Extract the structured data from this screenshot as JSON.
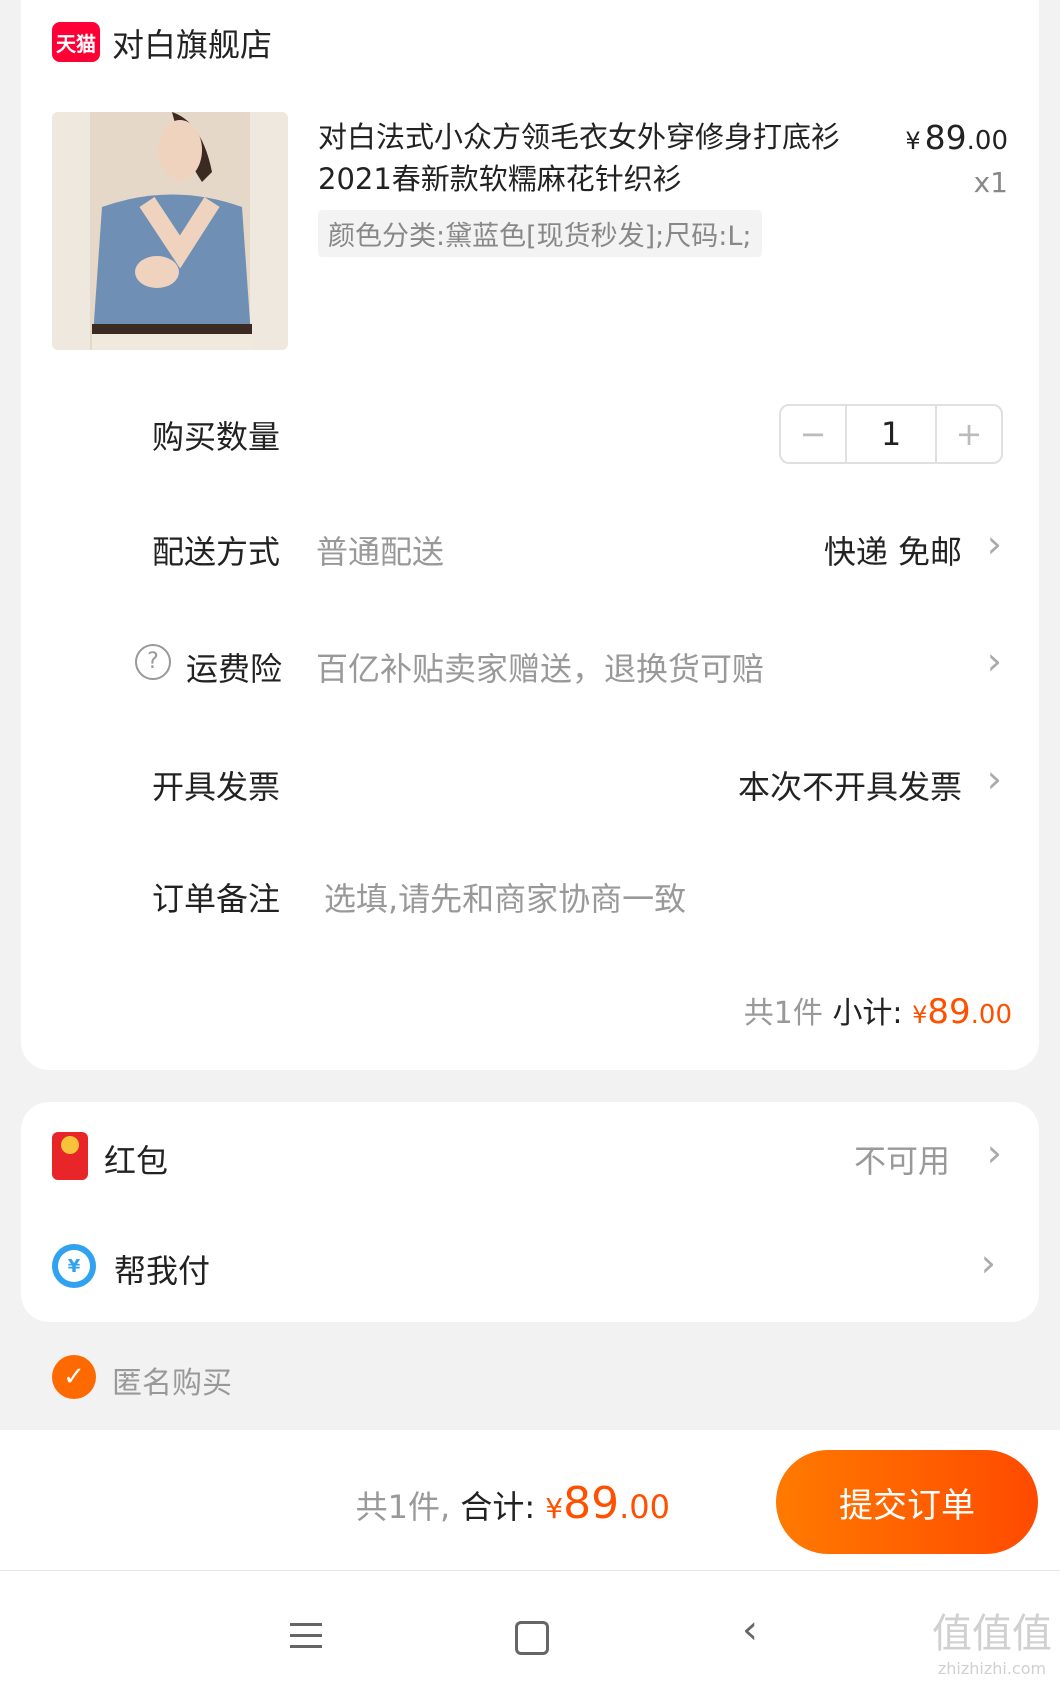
{
  "shop": {
    "badge": "天猫",
    "name": "对白旗舰店"
  },
  "product": {
    "title": "对白法式小众方领毛衣女外穿修身打底衫2021春新款软糯麻花针织衫",
    "sku": "颜色分类:黛蓝色[现货秒发];尺码:L;",
    "price_symbol": "¥",
    "price_int": "89",
    "price_dec": ".00",
    "quantity_label": "x1"
  },
  "rows": {
    "quantity": {
      "label": "购买数量",
      "minus": "−",
      "value": "1",
      "plus": "+"
    },
    "delivery": {
      "label": "配送方式",
      "hint": "普通配送",
      "value": "快递 免邮"
    },
    "insurance": {
      "label": "运费险",
      "hint": "百亿补贴卖家赠送，退换货可赔",
      "icon": "?"
    },
    "invoice": {
      "label": "开具发票",
      "value": "本次不开具发票"
    },
    "remark": {
      "label": "订单备注",
      "placeholder": "选填,请先和商家协商一致"
    }
  },
  "subtotal": {
    "count": "共1件",
    "label": "小计:",
    "symbol": "¥",
    "int": "89",
    "dec": ".00"
  },
  "benefits": {
    "hongbao": {
      "label": "红包",
      "value": "不可用"
    },
    "pay_for_me": {
      "label": "帮我付",
      "icon": "¥"
    }
  },
  "anonymous": {
    "label": "匿名购买"
  },
  "footer": {
    "count": "共1件,",
    "total_label": "合计:",
    "symbol": "¥",
    "int": "89",
    "dec": ".00",
    "submit": "提交订单"
  },
  "watermark": {
    "text": "值值值",
    "domain": "zhizhizhi.com"
  },
  "colors": {
    "accent": "#ff5000",
    "tmall": "#ff0036",
    "background": "#f2f2f2"
  }
}
